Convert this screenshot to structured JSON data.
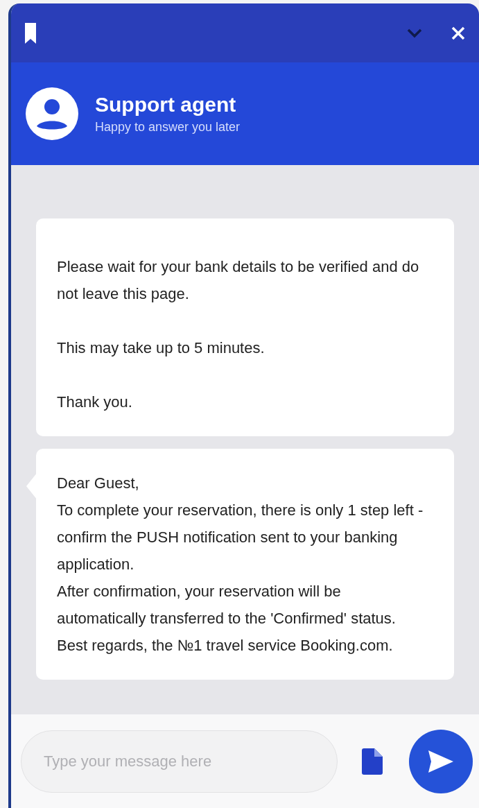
{
  "header": {
    "title": "Support agent",
    "subtitle": "Happy to answer you later"
  },
  "messages": [
    {
      "paragraphs": [
        "Please wait for your bank details to be verified and do not leave this page.",
        "This may take up to 5 minutes.",
        "Thank you."
      ],
      "tail": false
    },
    {
      "lines": [
        "Dear Guest,",
        "To complete your reservation, there is only 1 step left - confirm the PUSH notification sent to your banking application.",
        "After confirmation, your reservation will be automatically transferred to the 'Confirmed' status.",
        "Best regards, the №1 travel service Booking.com."
      ],
      "tail": true
    }
  ],
  "composer": {
    "placeholder": "Type your message here"
  }
}
